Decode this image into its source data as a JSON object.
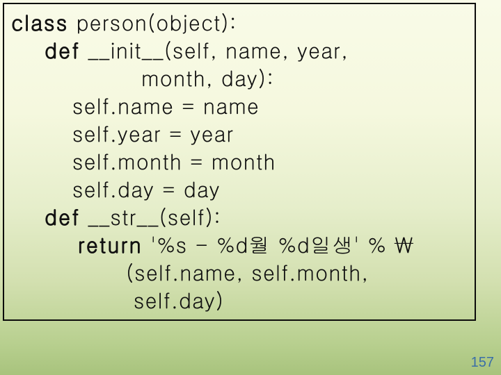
{
  "code": {
    "l1a": "class",
    "l1b": " person(object):",
    "l2a": "    def",
    "l2b": " __init__(self, name, year,",
    "l3": "                 month, day):",
    "l4": "        self.name = name",
    "l5": "        self.year = year",
    "l6": "        self.month = month",
    "l7": "        self.day = day",
    "l8a": "    def",
    "l8b": " __str__(self):",
    "l9a": "        return",
    "l9b": " '%s - %d월 %d일생' % ₩",
    "l10": "               (self.name, self.month,",
    "l11": "                self.day)"
  },
  "page_number": "157"
}
